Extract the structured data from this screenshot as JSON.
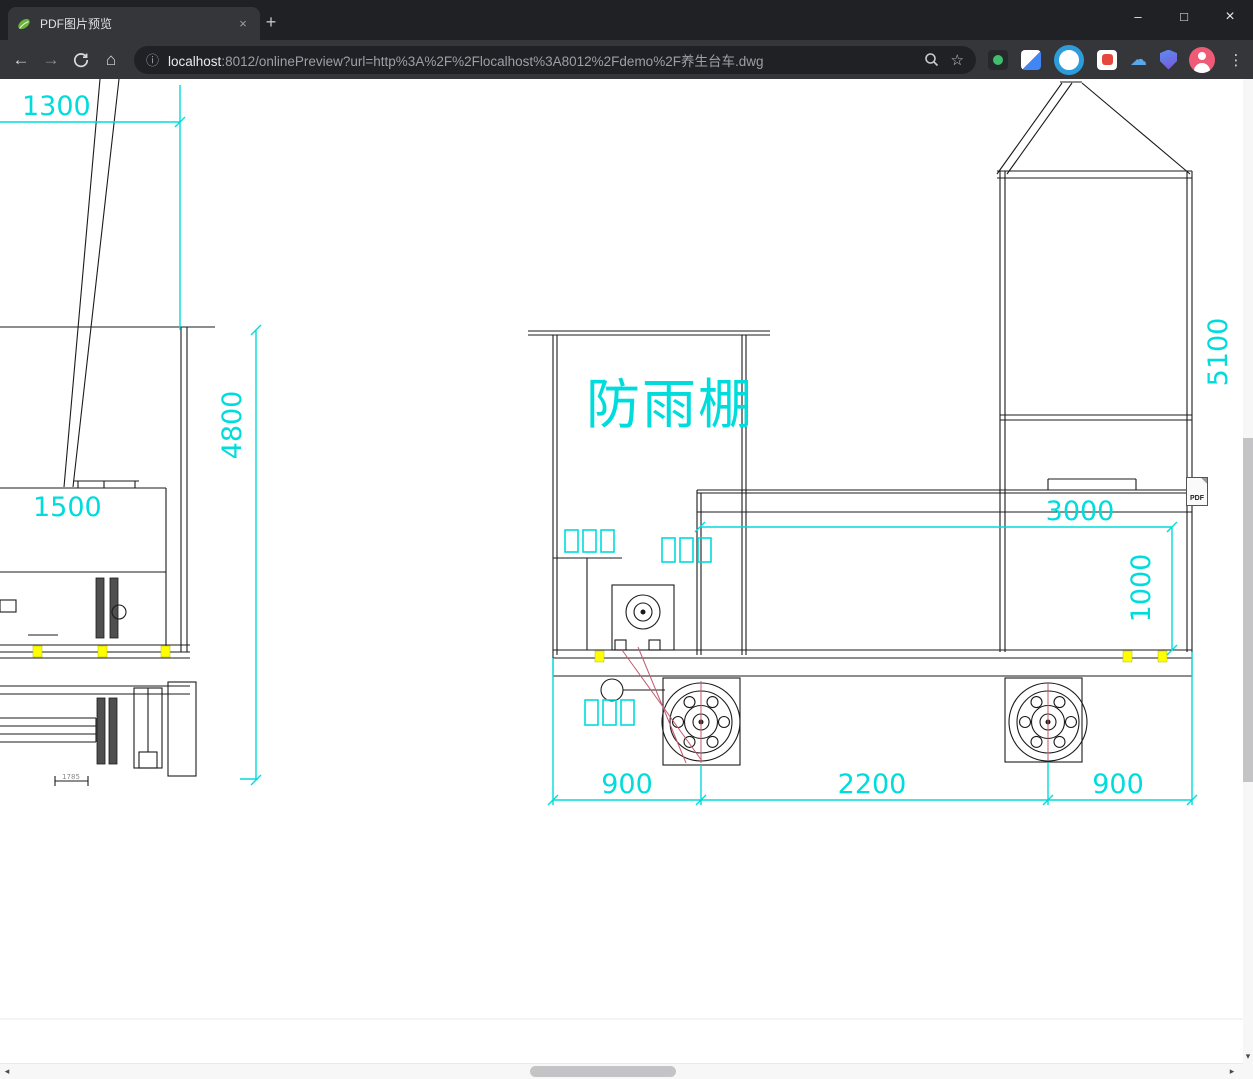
{
  "browser": {
    "tab_title": "PDF图片预览",
    "url_host": "localhost",
    "url_rest": ":8012/onlinePreview?url=http%3A%2F%2Flocalhost%3A8012%2Fdemo%2F养生台车.dwg",
    "icons": {
      "tab_close": "×",
      "new_tab": "+",
      "minimize": "–",
      "maximize": "□",
      "close": "×",
      "back": "←",
      "forward": "→",
      "home": "⌂",
      "info": "ⓘ",
      "star": "☆",
      "cloud": "☁",
      "menu": "⋮",
      "scroll_down": "▾",
      "scroll_left": "◂",
      "scroll_right": "▸"
    }
  },
  "drawing": {
    "colors": {
      "dimension": "#00dcdc",
      "line": "#1b1b1b",
      "highlight": "#ffff00",
      "accent": "#c25a70"
    },
    "labels": {
      "dim_1300": "1300",
      "dim_4800": "4800",
      "dim_1500": "1500",
      "dim_small": "1785",
      "shelter": "防雨棚",
      "dim_3000": "3000",
      "dim_1000": "1000",
      "dim_5100": "5100",
      "dim_900_left": "900",
      "dim_2200": "2200",
      "dim_900_right": "900"
    },
    "pdf_badge": "PDF"
  }
}
